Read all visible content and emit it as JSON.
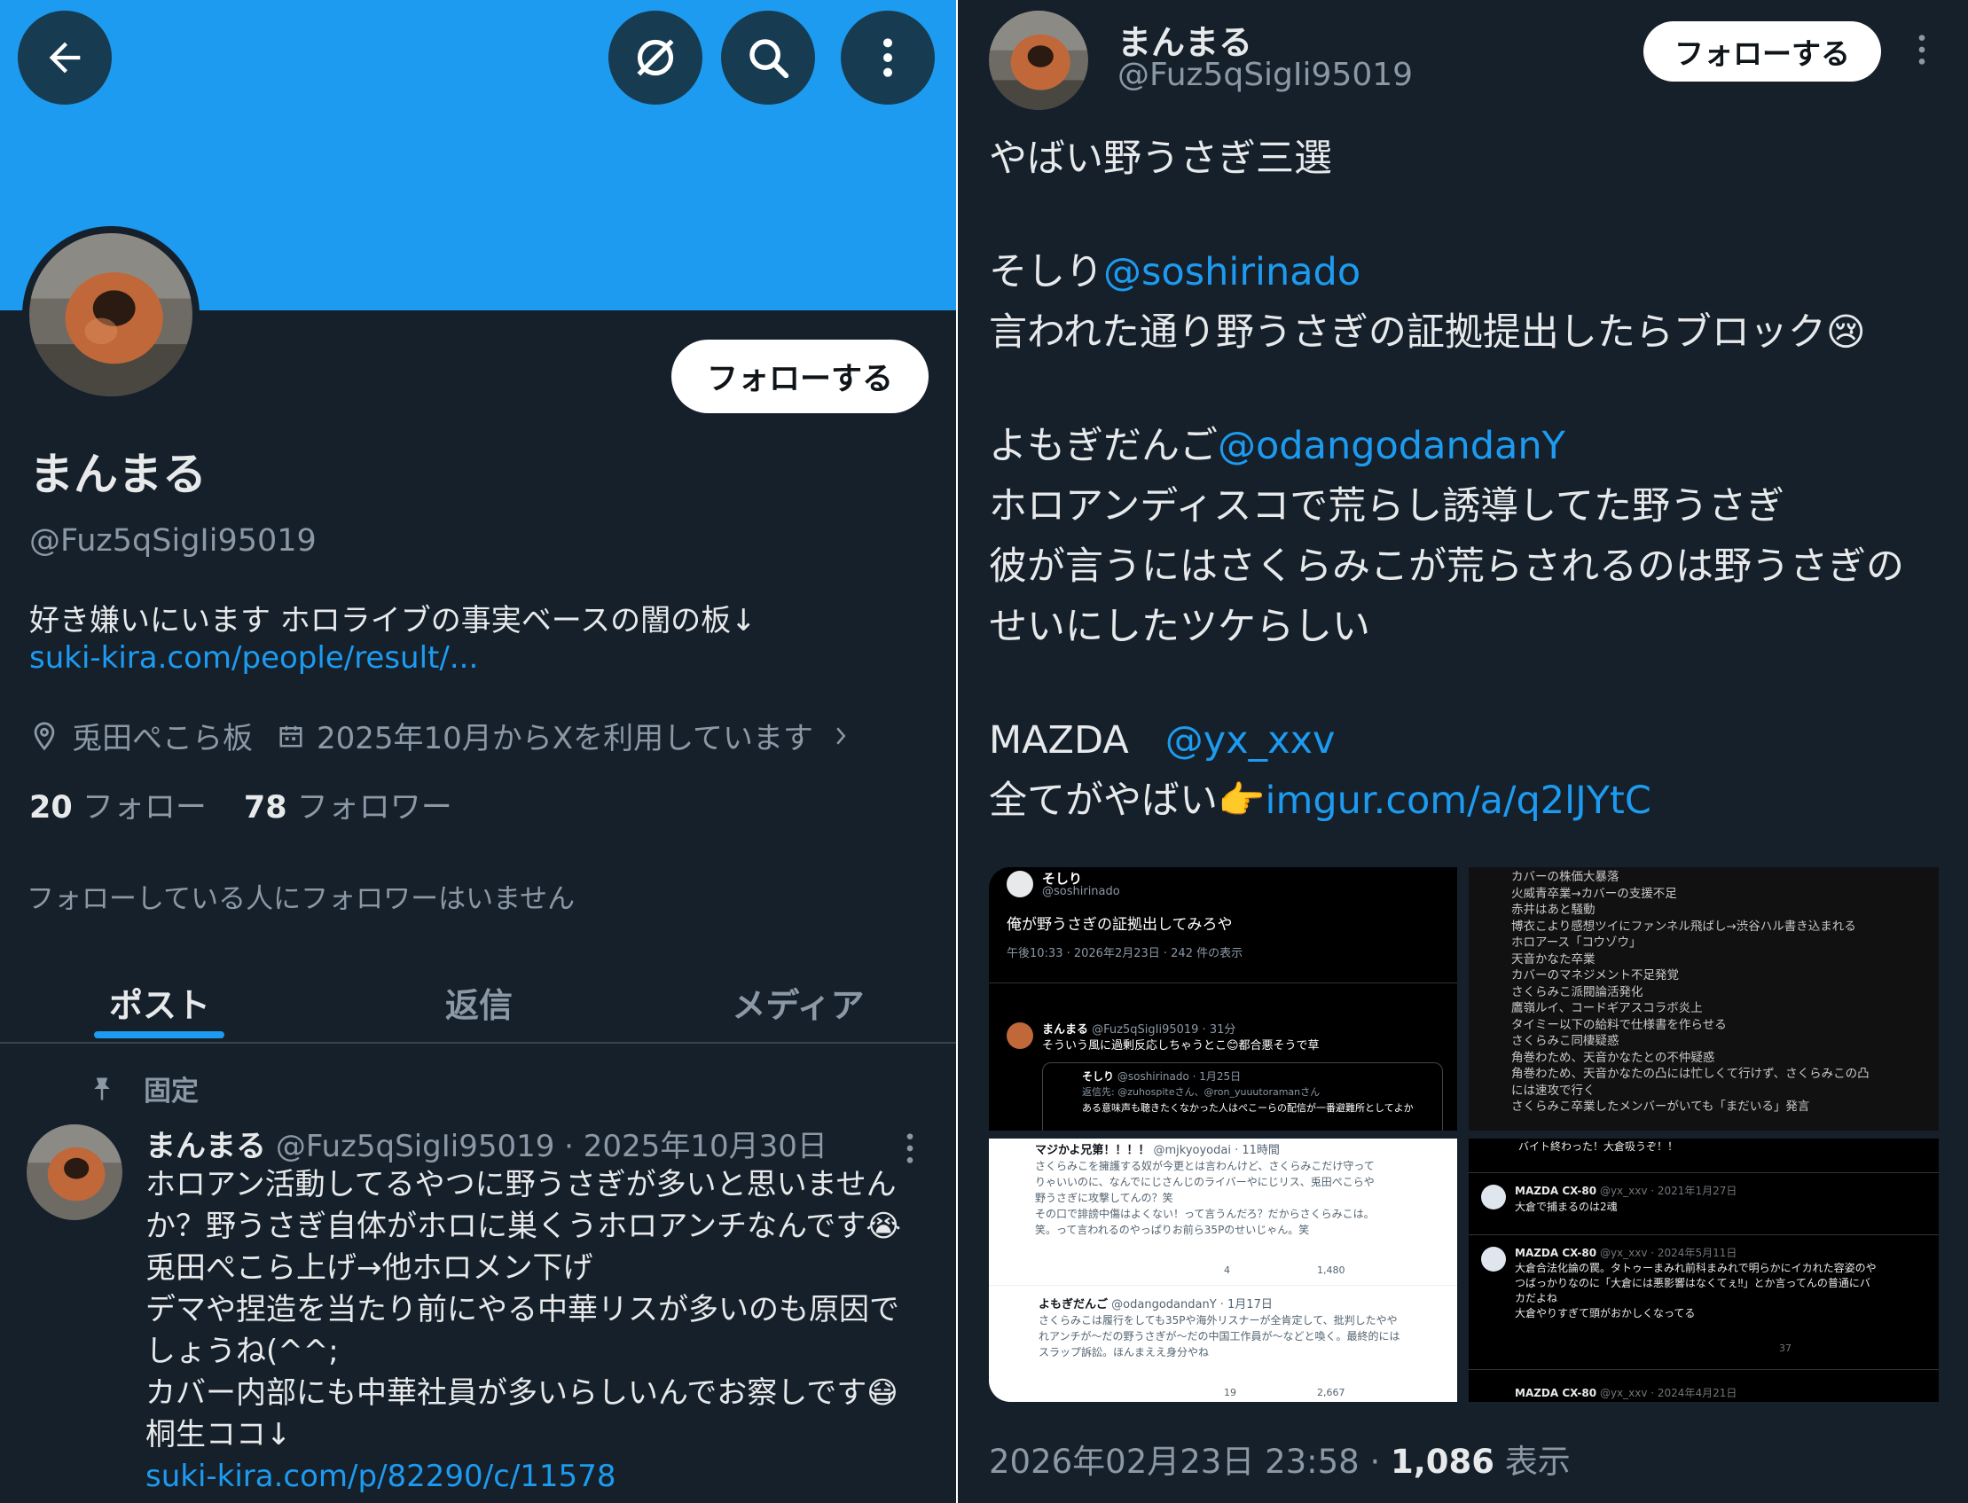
{
  "profile": {
    "name": "まんまる",
    "handle": "@Fuz5qSigIi95019",
    "bio": "好き嫌いにいます ホロライブの事実ベースの闇の板↓",
    "bio_link": "suki-kira.com/people/result/...",
    "location": "兎田ぺこら板",
    "joined": "2025年10月からXを利用しています",
    "following_count": "20",
    "following_label": "フォロー",
    "followers_count": "78",
    "followers_label": "フォロワー",
    "no_mutuals": "フォローしている人にフォロワーはいません",
    "follow_button": "フォローする"
  },
  "tabs": [
    "ポスト",
    "返信",
    "メディア"
  ],
  "pinned_post": {
    "pinned_label": "固定",
    "name": "まんまる",
    "handle_date": "@Fuz5qSigIi95019 · 2025年10月30日",
    "lines": [
      "ホロアン活動してるやつに野うさぎが多いと思いません",
      "か？野うさぎ自体がホロに巣くうホロアンチなんです😭",
      "兎田ぺこら上げ→他ホロメン下げ",
      "デマや捏造を当たり前にやる中華リスが多いのも原因で",
      "しょうね(^^;",
      "カバー内部にも中華社員が多いらしいんでお察しです😷",
      "桐生ココ↓"
    ],
    "link": "suki-kira.com/p/82290/c/11578"
  },
  "tweet": {
    "name": "まんまる",
    "handle": "@Fuz5qSigIi95019",
    "follow_button": "フォローする",
    "title": "やばい野うさぎ三選",
    "p1_name": "そしり",
    "p1_mention": "@soshirinado",
    "p1_text": "言われた通り野うさぎの証拠提出したらブロック😢",
    "p2_name": "よもぎだんご",
    "p2_mention": "@odangodandanY",
    "p2_line1": "ホロアンディスコで荒らし誘導してた野うさぎ",
    "p2_line2": "彼が言うにはさくらみこが荒らされるのは野うさぎの",
    "p2_line3": "せいにしたツケらしい",
    "p3_name": "MAZDA",
    "p3_mention": "@yx_xxv",
    "p3_text": "全てがやばい👉",
    "p3_link": "imgur.com/a/q2lJYtC",
    "timestamp": "2026年02月23日 23:58 · ",
    "views": "1,086",
    "views_label": "表示"
  },
  "media": {
    "img1": {
      "name": "そしり",
      "handle": "@soshirinado",
      "text": "俺が野うさぎの証拠出してみろや",
      "meta": "午後10:33 · 2026年2月23日 · 242 件の表示",
      "reply_name": "まんまる",
      "reply_meta": "@Fuz5qSigIi95019 · 31分",
      "reply_text": "そういう風に過剰反応しちゃうとこ😊都合悪そうで草",
      "quote_name": "そしり",
      "quote_meta": "@soshirinado · 1月25日",
      "quote_reply": "返信先: @zuhospiteさん、@ron_yuuutoramanさん",
      "quote_text": "ある意味声も聴きたくなかった人はぺこーらの配信が一番避難所としてよか"
    },
    "img2": {
      "lines": [
        "カバーの株価大暴落",
        "火威青卒業→カバーの支援不足",
        "赤井はあと騒動",
        "博衣こより感想ツイにファンネル飛ばし→渋谷ハル書き込まれる",
        "ホロアース「コウゾウ」",
        "天音かなた卒業",
        "カバーのマネジメント不足発覚",
        "さくらみこ派閥論活発化",
        "鷹嶺ルイ、コードギアスコラボ炎上",
        "タイミー以下の給料で仕様書を作らせる",
        "さくらみこ同棲疑惑",
        "角巻わため、天音かなたとの不仲疑惑",
        "角巻わため、天音かなたの凸には忙しくて行けず、さくらみこの凸",
        "には速攻で行く",
        "さくらみこ卒業したメンバーがいても「まだいる」発言"
      ]
    },
    "img3": {
      "top_name": "マジかよ兄第！！！！",
      "top_meta": "@mjkyoyodai · 11時間",
      "top_text": [
        "さくらみこを擁護する奴が今更とは言わんけど、さくらみこだけ守って",
        "りゃいいのに、なんでにじさんじのライバーやにじリス、兎田ぺこらや",
        "野うさぎに攻撃してんの？笑",
        "その口で誹謗中傷はよくない！って言うんだろ？だからさくらみこは。",
        "笑。って言われるのやっぱりお前ら35Pのせいじゃん。笑"
      ],
      "top_likes": "4",
      "top_views": "1,480",
      "bottom_name": "よもぎだんご",
      "bottom_meta": "@odangodandanY · 1月17日",
      "bottom_text": [
        "さくらみこは履行をしても35Pや海外リスナーが全肯定して、批判したやや",
        "れアンチが〜だの野うさぎが〜だの中国工作員が〜などと喚く。最終的には",
        "スラップ訴訟。ほんまええ身分やね"
      ],
      "bottom_likes": "19",
      "bottom_views": "2,667"
    },
    "img4": {
      "top_text": "バイト終わった！大倉吸うぞ！！",
      "post1_name": "MAZDA CX-80",
      "post1_meta": "@yx_xxv · 2021年1月27日",
      "post1_text": "大倉で捕まるのは2魂",
      "post2_name": "MAZDA CX-80",
      "post2_meta": "@yx_xxv · 2024年5月11日",
      "post2_text": [
        "大倉合法化論の罠。タトゥーまみれ前科まみれで明らかにイカれた容姿のや",
        "つばっかりなのに「大倉には悪影響はなくてぇ‼」とか言ってんの普通にバ",
        "カだよね",
        "大倉やりすぎて頭がおかしくなってる"
      ],
      "post2_views": "37",
      "post3_name": "MAZDA CX-80",
      "post3_meta": "@yx_xxv · 2024年4月21日"
    }
  },
  "colors": {
    "background": "#15202b",
    "banner": "#1d9bf0",
    "accent": "#1d9bf0",
    "text": "#e7e9ea",
    "muted": "#8b98a5"
  },
  "icons": [
    "back-arrow-icon",
    "grok-slash-icon",
    "search-icon",
    "more-vertical-icon",
    "location-icon",
    "calendar-icon",
    "chevron-right-icon",
    "pin-icon"
  ]
}
